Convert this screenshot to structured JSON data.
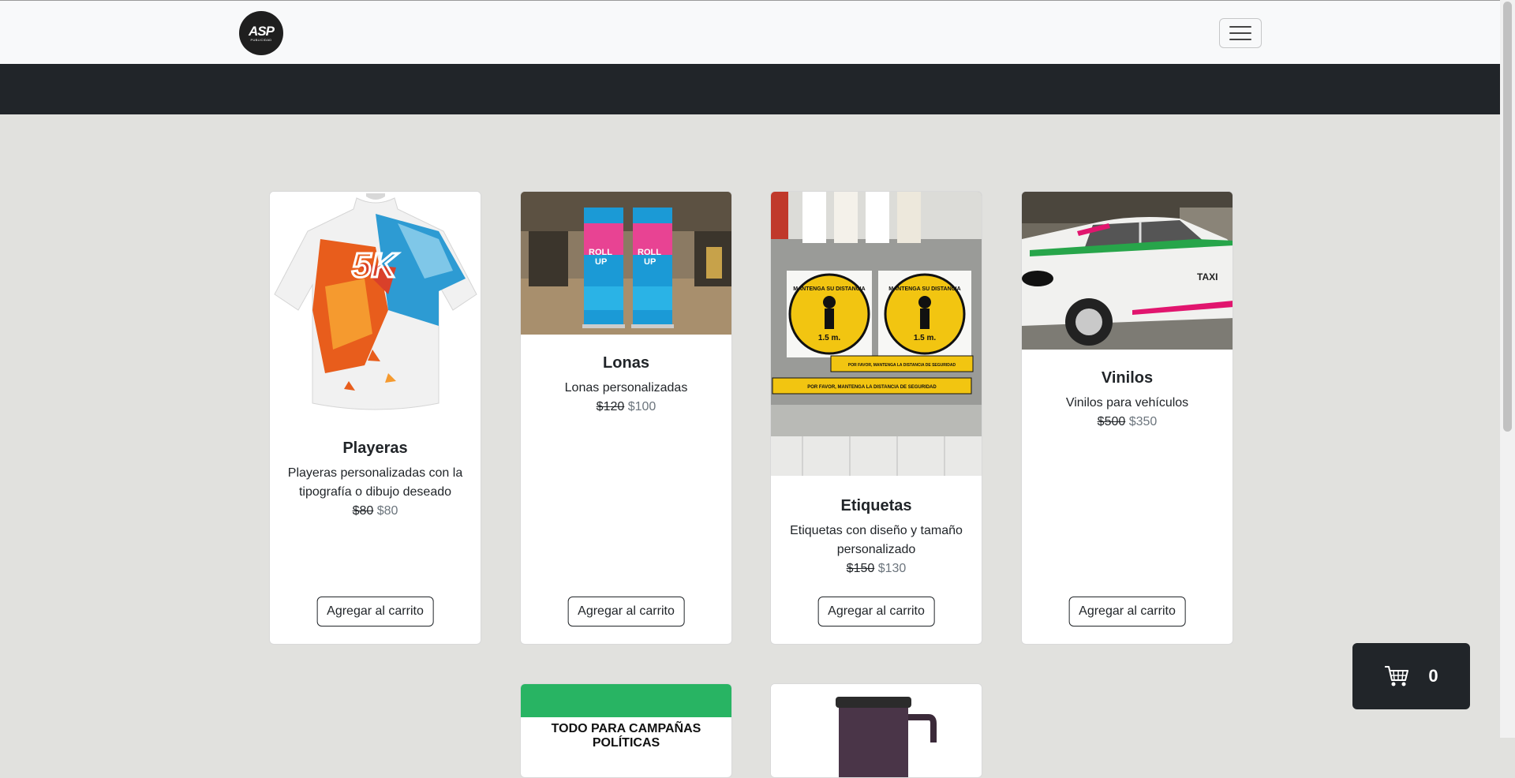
{
  "brand": {
    "logo_text": "ASP",
    "logo_subtext": "PUBLICIDAD"
  },
  "nav": {
    "toggle_icon": "hamburger-icon"
  },
  "products": [
    {
      "title": "Playeras",
      "description": "Playeras personalizadas con la tipografía o dibujo deseado",
      "old_price": "$80",
      "price": "$80",
      "button": "Agregar al carrito"
    },
    {
      "title": "Lonas",
      "description": "Lonas personalizadas",
      "old_price": "$120",
      "price": "$100",
      "button": "Agregar al carrito",
      "image_text": [
        "ROLL",
        "UP",
        "ROLL",
        "UP"
      ]
    },
    {
      "title": "Etiquetas",
      "description": "Etiquetas con diseño y tamaño personalizado",
      "old_price": "$150",
      "price": "$130",
      "button": "Agregar al carrito",
      "image_text": [
        "MANTENGA SU DISTANCIA",
        "1.5 m.",
        "MANTENGA SU DISTANCIA",
        "1.5 m.",
        "POR FAVOR, MANTENGA LA DISTANCIA DE SEGURIDAD",
        "POR FAVOR, MANTENGA LA DISTANCIA DE SEGURIDAD"
      ]
    },
    {
      "title": "Vinilos",
      "description": "Vinilos para vehículos",
      "old_price": "$500",
      "price": "$350",
      "button": "Agregar al carrito",
      "image_text": [
        "TAXI"
      ]
    }
  ],
  "partial_cards": [
    {
      "banner_text": "TODO PARA CAMPAÑAS POLÍTICAS"
    },
    {
      "image": "mug"
    }
  ],
  "cart": {
    "icon": "shopping-cart-icon",
    "count": "0"
  },
  "colors": {
    "navbar_bg": "#f8f9fa",
    "dark_band": "#212529",
    "page_bg": "#e1e1de",
    "accent_green": "#28b463"
  }
}
